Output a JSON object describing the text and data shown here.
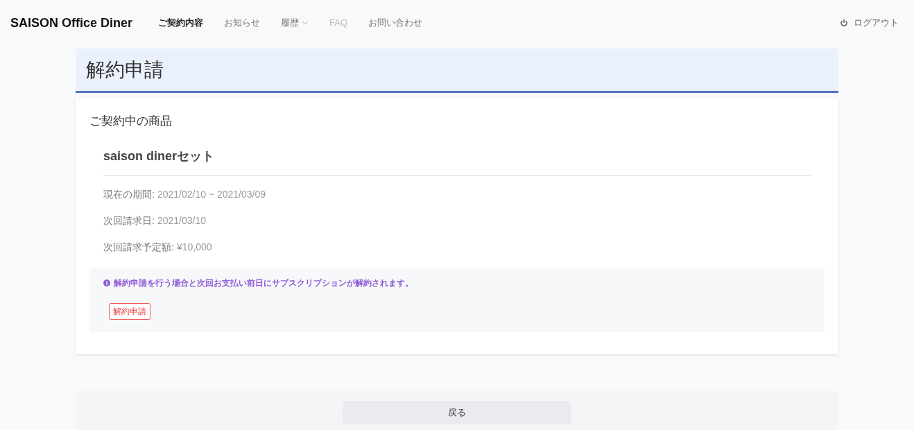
{
  "header": {
    "brand": "SAISON Office Diner",
    "nav": [
      {
        "label": "ご契約内容",
        "selected": true,
        "disabled": false,
        "kind": "link"
      },
      {
        "label": "お知らせ",
        "selected": false,
        "disabled": false,
        "kind": "link"
      },
      {
        "label": "履歴",
        "selected": false,
        "disabled": false,
        "kind": "dropdown"
      },
      {
        "label": "FAQ",
        "selected": false,
        "disabled": true,
        "kind": "link"
      },
      {
        "label": "お問い合わせ",
        "selected": false,
        "disabled": false,
        "kind": "link"
      }
    ],
    "logout": "ログアウト"
  },
  "page_title": "解約申請",
  "card": {
    "heading": "ご契約中の商品",
    "product": "saison dinerセット",
    "details": [
      {
        "label": "現在の期間:",
        "value": "2021/02/10 ~ 2021/03/09"
      },
      {
        "label": "次回請求日:",
        "value": "2021/03/10"
      },
      {
        "label": "次回請求予定額:",
        "value": "¥10,000"
      }
    ],
    "notice": "解約申請を行う場合と次回お支払い前日にサブスクリプションが解約されます。",
    "cancel_button": "解約申請"
  },
  "back_button": "戻る"
}
